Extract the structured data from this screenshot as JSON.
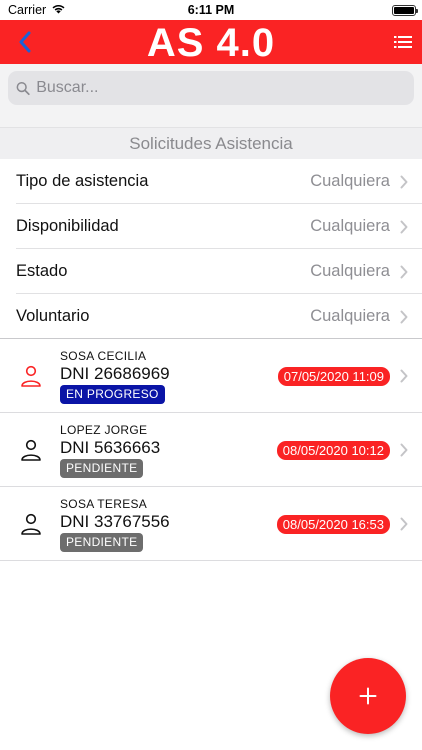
{
  "status_bar": {
    "carrier": "Carrier",
    "time": "6:11 PM"
  },
  "header": {
    "title": "AS 4.0",
    "back_icon": "chevron-left-icon",
    "menu_icon": "list-icon",
    "brand_color": "#fa2324"
  },
  "search": {
    "placeholder": "Buscar..."
  },
  "section": {
    "title": "Solicitudes Asistencia"
  },
  "filters": [
    {
      "label": "Tipo de asistencia",
      "value": "Cualquiera"
    },
    {
      "label": "Disponibilidad",
      "value": "Cualquiera"
    },
    {
      "label": "Estado",
      "value": "Cualquiera"
    },
    {
      "label": "Voluntario",
      "value": "Cualquiera"
    }
  ],
  "requests": [
    {
      "name": "SOSA CECILIA",
      "dni": "DNI 26686969",
      "status": "EN PROGRESO",
      "status_color": "#0a14a6",
      "date": "07/05/2020 11:09",
      "avatar_color": "#fa2324"
    },
    {
      "name": "LOPEZ JORGE",
      "dni": "DNI 5636663",
      "status": "PENDIENTE",
      "status_color": "#6d6d6d",
      "date": "08/05/2020 10:12",
      "avatar_color": "#111111"
    },
    {
      "name": "SOSA TERESA",
      "dni": "DNI 33767556",
      "status": "PENDIENTE",
      "status_color": "#6d6d6d",
      "date": "08/05/2020 16:53",
      "avatar_color": "#111111"
    }
  ],
  "fab": {
    "icon": "plus-icon"
  }
}
